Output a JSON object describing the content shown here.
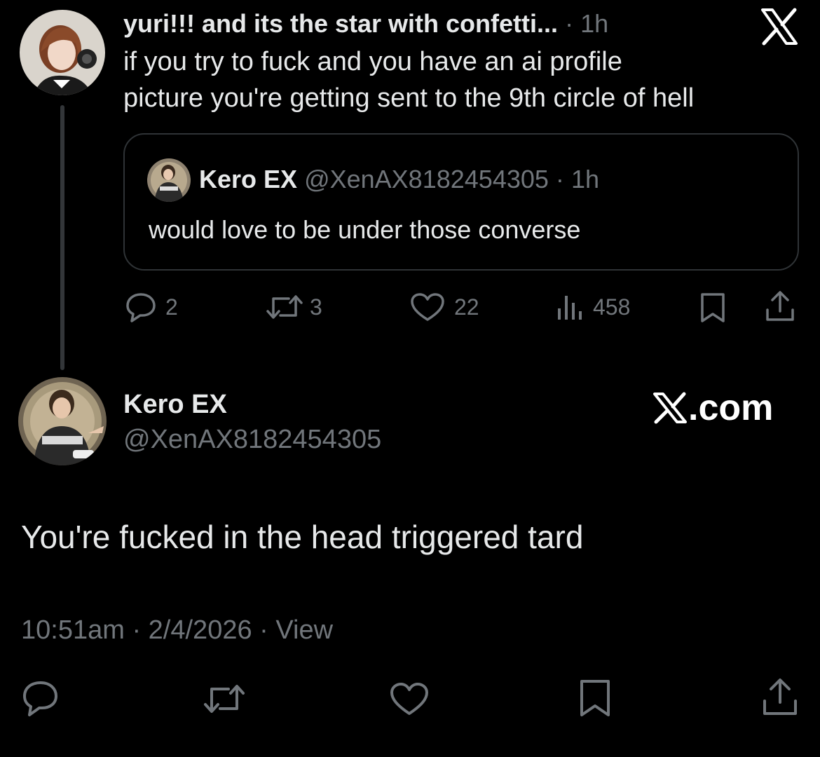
{
  "parent": {
    "display_name": "yuri!!! and its the star with confetti...",
    "time": "1h",
    "text_line1": "if you try to fuck and you have an ai profile",
    "text_line2": "picture you're getting sent to the 9th circle of hell",
    "avatar_icon": "user-avatar-photo"
  },
  "quote": {
    "display_name": "Kero EX",
    "handle": "@XenAX8182454305",
    "time": "1h",
    "text": "would love to be under those converse"
  },
  "parent_actions": {
    "replies": "2",
    "reposts": "3",
    "likes": "22",
    "views": "458"
  },
  "reply": {
    "display_name": "Kero EX",
    "handle": "@XenAX8182454305",
    "brand": "com",
    "text": "You're fucked in the head triggered tard",
    "timestamp": "10:51am",
    "date": "2/4/2026",
    "view_label": "View"
  },
  "colors": {
    "background": "#000000",
    "text": "#e7e9ea",
    "secondary": "#71767b",
    "border": "#2f3336"
  }
}
